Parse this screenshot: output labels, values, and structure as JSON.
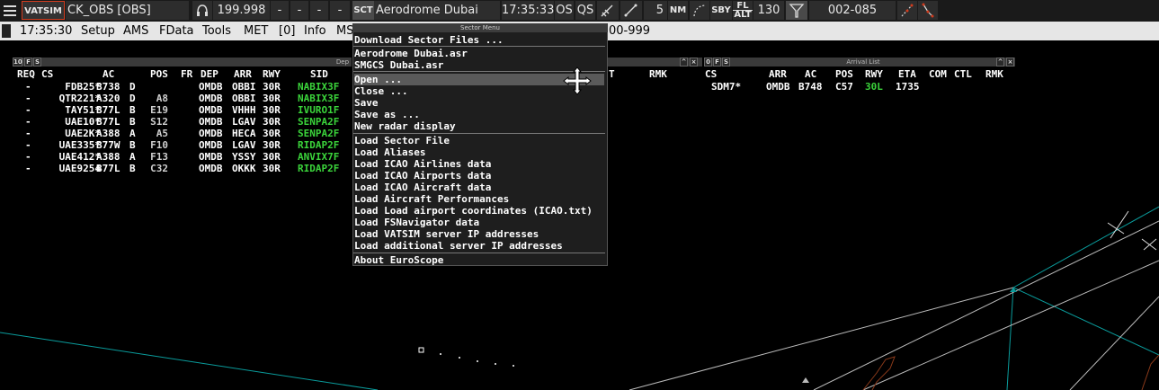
{
  "toolbar": {
    "brand": "VATSIM",
    "callsign": "CK_OBS [OBS]",
    "frequency": "199.998",
    "dash1": "-",
    "dash2": "-",
    "dash3": "-",
    "dash4": "-",
    "sct": "SCT",
    "sector_name": "Aerodrome Dubai",
    "time": "17:35:33",
    "os": "OS",
    "qs": "QS",
    "range": "5",
    "nm": "NM",
    "sby": "SBY",
    "fl_top": "FL",
    "fl_bottom": "ALT",
    "transition_level": "130",
    "squawk_range": "002-085"
  },
  "menubar": {
    "time": "17:35:30",
    "items": [
      "Setup",
      "AMS",
      "FData",
      "Tools",
      "MET",
      "[0]",
      "Info",
      "MS"
    ],
    "trailing": "00-999"
  },
  "departure_list": {
    "title": "Dep",
    "count": "10",
    "f_btn": "F",
    "s_btn": "S",
    "headers": [
      "REQ",
      "CS",
      "AC",
      "POS",
      "FR",
      "DEP",
      "ARR",
      "RWY",
      "SID"
    ],
    "rows": [
      {
        "req": "-",
        "cs": "FDB25*",
        "ac": "B738",
        "wtc": "D",
        "pos": "",
        "dep": "OMDB",
        "arr": "OBBI",
        "rwy": "30R",
        "sid": "NABIX3F"
      },
      {
        "req": "-",
        "cs": "QTR221*",
        "ac": "A320",
        "wtc": "D",
        "pos": "A8",
        "dep": "OMDB",
        "arr": "OBBI",
        "rwy": "30R",
        "sid": "NABIX3F"
      },
      {
        "req": "-",
        "cs": "TAY51*",
        "ac": "B77L",
        "wtc": "B",
        "pos": "E19",
        "dep": "OMDB",
        "arr": "VHHH",
        "rwy": "30R",
        "sid": "IVURO1F"
      },
      {
        "req": "-",
        "cs": "UAE10*",
        "ac": "B77L",
        "wtc": "B",
        "pos": "S12",
        "dep": "OMDB",
        "arr": "LGAV",
        "rwy": "30R",
        "sid": "SENPA2F"
      },
      {
        "req": "-",
        "cs": "UAE2K*",
        "ac": "A388",
        "wtc": "A",
        "pos": "A5",
        "dep": "OMDB",
        "arr": "HECA",
        "rwy": "30R",
        "sid": "SENPA2F"
      },
      {
        "req": "-",
        "cs": "UAE335*",
        "ac": "B77W",
        "wtc": "B",
        "pos": "F10",
        "dep": "OMDB",
        "arr": "LGAV",
        "rwy": "30R",
        "sid": "RIDAP2F"
      },
      {
        "req": "-",
        "cs": "UAE412*",
        "ac": "A388",
        "wtc": "A",
        "pos": "F13",
        "dep": "OMDB",
        "arr": "YSSY",
        "rwy": "30R",
        "sid": "ANVIX7F"
      },
      {
        "req": "-",
        "cs": "UAE9254",
        "ac": "B77L",
        "wtc": "B",
        "pos": "C32",
        "dep": "OMDB",
        "arr": "OKKK",
        "rwy": "30R",
        "sid": "RIDAP2F"
      }
    ],
    "extra_headers": [
      "T",
      "RMK"
    ]
  },
  "arrival_list": {
    "title": "Arrival List",
    "count": "0",
    "f_btn": "F",
    "s_btn": "S",
    "headers": [
      "CS",
      "ARR",
      "AC",
      "POS",
      "RWY",
      "ETA",
      "COM",
      "CTL",
      "RMK"
    ],
    "rows": [
      {
        "cs": "SDM7*",
        "arr": "OMDB",
        "ac": "B748",
        "pos": "C57",
        "rwy": "30L",
        "eta": "1735"
      }
    ]
  },
  "sector_menu": {
    "title": "Sector Menu",
    "items": [
      "Download Sector Files ...",
      "Aerodrome Dubai.asr",
      "SMGCS Dubai.asr",
      "Open ...",
      "Close ...",
      "Save",
      "Save as ...",
      "New radar display",
      "Load Sector File",
      "Load Aliases",
      "Load ICAO Airlines data",
      "Load ICAO Airports data",
      "Load ICAO Aircraft data",
      "Load Aircraft Performances",
      "Load Load airport coordinates (ICAO.txt)",
      "Load FSNavigator data",
      "Load VATSIM server IP addresses",
      "Load additional server IP addresses",
      "About EuroScope"
    ],
    "highlighted_index": 3
  },
  "colors": {
    "background": "#000000",
    "sid_green": "#3bd43b",
    "radar_line": "#00a0a0",
    "toolbar_bg": "#2d2d2d",
    "brand_red": "#d23c1e"
  }
}
